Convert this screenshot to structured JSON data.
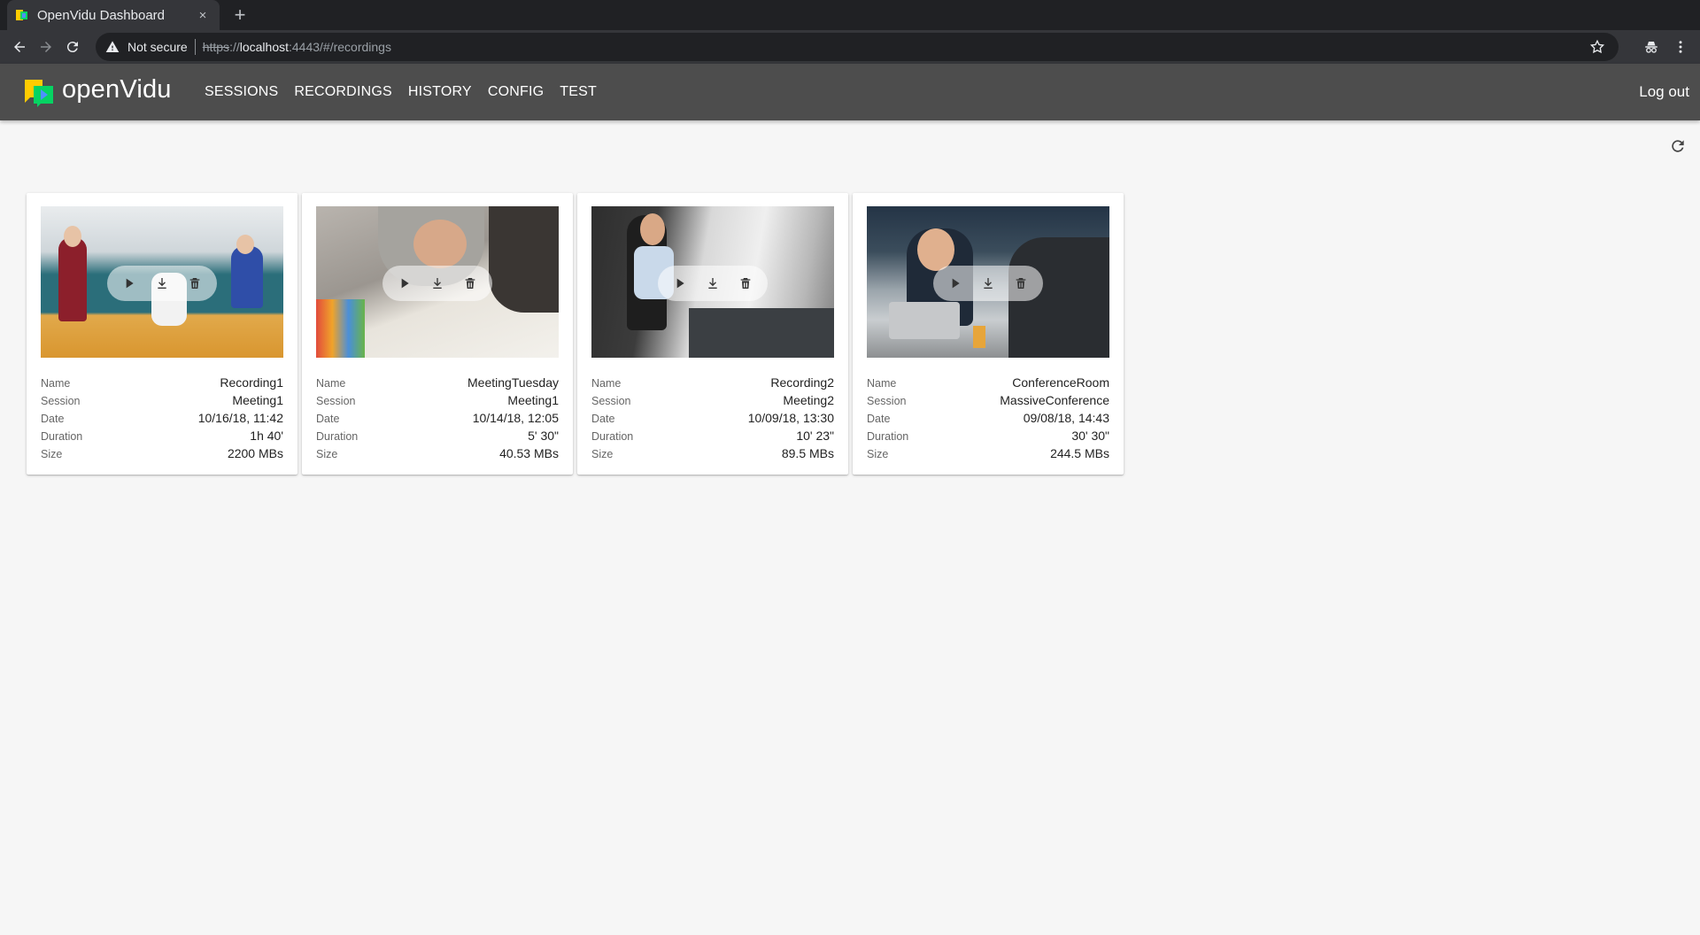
{
  "browser": {
    "tab_title": "OpenVidu Dashboard",
    "tab_close": "×",
    "new_tab": "+",
    "not_secure": "Not secure",
    "url_protocol": "https",
    "url_sep": "://",
    "url_host": "localhost",
    "url_path": ":4443/#/recordings"
  },
  "app": {
    "logo_text": "openVidu",
    "nav": [
      "SESSIONS",
      "RECORDINGS",
      "HISTORY",
      "CONFIG",
      "TEST"
    ],
    "logout": "Log out"
  },
  "labels": {
    "name": "Name",
    "session": "Session",
    "date": "Date",
    "duration": "Duration",
    "size": "Size"
  },
  "recordings": [
    {
      "name": "Recording1",
      "session": "Meeting1",
      "date": "10/16/18, 11:42",
      "duration": "1h 40'",
      "size": "2200 MBs"
    },
    {
      "name": "MeetingTuesday",
      "session": "Meeting1",
      "date": "10/14/18, 12:05",
      "duration": "5' 30\"",
      "size": "40.53 MBs"
    },
    {
      "name": "Recording2",
      "session": "Meeting2",
      "date": "10/09/18, 13:30",
      "duration": "10' 23\"",
      "size": "89.5 MBs"
    },
    {
      "name": "ConferenceRoom",
      "session": "MassiveConference",
      "date": "09/08/18, 14:43",
      "duration": "30' 30\"",
      "size": "244.5 MBs"
    }
  ],
  "colors": {
    "header_bg": "#4d4d4d",
    "page_bg": "#f6f6f6",
    "logo_yellow": "#ffcc00",
    "logo_green": "#06d362",
    "logo_blue": "#4d91ff"
  }
}
